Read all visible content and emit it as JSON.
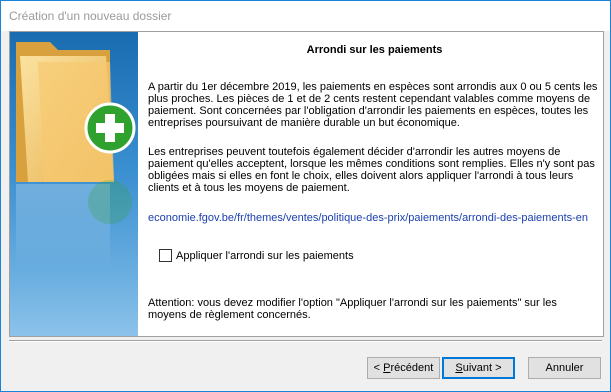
{
  "window": {
    "title": "Création d'un nouveau dossier"
  },
  "main": {
    "heading": "Arrondi sur les paiements",
    "paragraph1": "A partir du 1er décembre 2019, les paiements en espèces sont arrondis aux 0 ou 5 cents les plus proches. Les pièces de 1 et de 2 cents restent cependant valables comme moyens de paiement. Sont concernées par l'obligation d'arrondir les paiements en espèces, toutes les entreprises poursuivant de manière durable un but économique.",
    "paragraph2": "Les entreprises peuvent toutefois également décider d'arrondir les autres moyens de paiement qu'elles acceptent, lorsque les mêmes conditions sont remplies. Elles n'y sont pas obligées mais si elles en font le choix, elles doivent alors appliquer l'arrondi à tous leurs clients et à tous les moyens de paiement.",
    "link": "economie.fgov.be/fr/themes/ventes/politique-des-prix/paiements/arrondi-des-paiements-en",
    "checkbox_label": "Appliquer l'arrondi sur les paiements",
    "checkbox_checked": false,
    "note": "Attention: vous devez modifier l'option \"Appliquer l'arrondi sur les paiements\" sur les moyens de règlement concernés."
  },
  "buttons": {
    "previous_prefix": "< ",
    "previous_mnemonic": "P",
    "previous_rest": "récédent",
    "next_mnemonic": "S",
    "next_rest": "uivant >",
    "cancel": "Annuler"
  },
  "colors": {
    "accent": "#0078d7",
    "link": "#1a3fb0",
    "side_panel": "#2a7cc0",
    "plus_icon": "#2fa12f"
  }
}
